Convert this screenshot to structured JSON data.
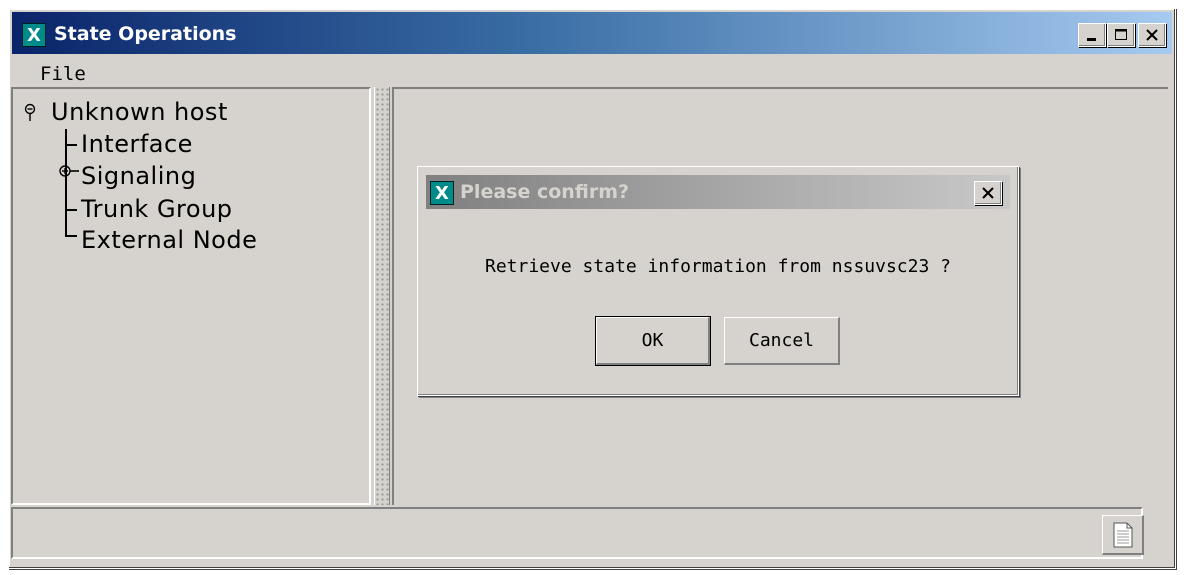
{
  "window": {
    "title": "State Operations",
    "app_icon_letter": "X",
    "controls": {
      "minimize": "minimize",
      "maximize": "maximize",
      "close": "close"
    }
  },
  "menu": {
    "file": "File"
  },
  "tree": {
    "root": "Unknown host",
    "children": [
      "Interface",
      "Signaling",
      "Trunk Group",
      "External Node"
    ]
  },
  "dialog": {
    "title": "Please confirm?",
    "icon_letter": "X",
    "message": "Retrieve state information from nssuvsc23 ?",
    "ok_label": "OK",
    "cancel_label": "Cancel"
  },
  "colors": {
    "titlebar_start": "#0a246a",
    "titlebar_end": "#a6caf0",
    "window_bg": "#d6d3ce",
    "icon_teal": "#008b8b"
  }
}
